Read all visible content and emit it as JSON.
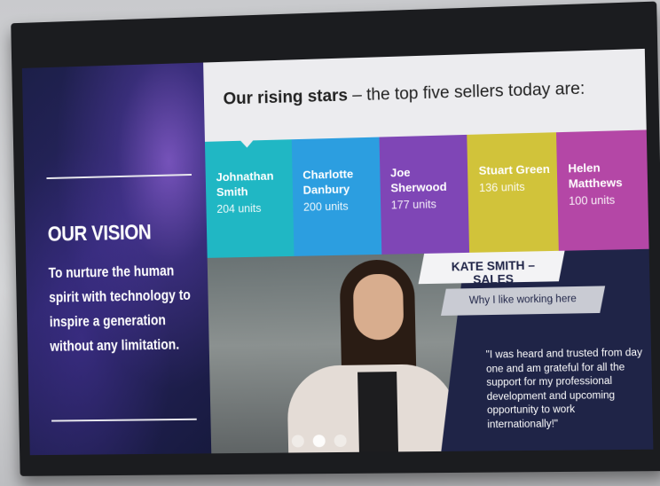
{
  "vision": {
    "title": "OUR VISION",
    "text": "To nurture the human spirit with technology to inspire a generation without any limitation."
  },
  "header": {
    "title_bold": "Our rising stars",
    "title_rest": " – the top five sellers today are:"
  },
  "sellers": [
    {
      "name": "Johnathan Smith",
      "units": "204 units",
      "color": "#20b7c4"
    },
    {
      "name": "Charlotte Danbury",
      "units": "200 units",
      "color": "#2c9ee0"
    },
    {
      "name": "Joe Sherwood",
      "units": "177 units",
      "color": "#7f46b6"
    },
    {
      "name": "Stuart Green",
      "units": "136 units",
      "color": "#d1c33a"
    },
    {
      "name": "Helen Matthews",
      "units": "100 units",
      "color": "#b447a6"
    }
  ],
  "profile": {
    "name_tag": "KATE SMITH – SALES",
    "subtitle": "Why I like working here",
    "quote": "\"I was heard and trusted from day one and am grateful for all the support for my professional development and upcoming opportunity to work internationally!\""
  },
  "carousel": {
    "total": 3,
    "active_index": 1
  },
  "colors": {
    "navy": "#1f2447",
    "header_bg": "#ececef"
  }
}
